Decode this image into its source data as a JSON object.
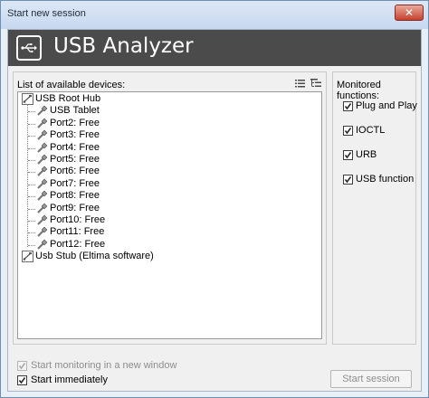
{
  "window": {
    "title": "Start new session",
    "close_glyph": "✕"
  },
  "header": {
    "app_title": "USB Analyzer",
    "logo_icon": "usb-icon"
  },
  "devices": {
    "label": "List of available devices:",
    "view_icons": [
      "list-view-icon",
      "tree-view-icon"
    ],
    "tree": [
      {
        "label": "USB Root Hub",
        "icon": "usb-hub-icon",
        "level": 0
      },
      {
        "label": "USB Tablet",
        "icon": "usb-plug-icon",
        "level": 1
      },
      {
        "label": "Port2: Free",
        "icon": "usb-plug-icon",
        "level": 1
      },
      {
        "label": "Port3: Free",
        "icon": "usb-plug-icon",
        "level": 1
      },
      {
        "label": "Port4: Free",
        "icon": "usb-plug-icon",
        "level": 1
      },
      {
        "label": "Port5: Free",
        "icon": "usb-plug-icon",
        "level": 1
      },
      {
        "label": "Port6: Free",
        "icon": "usb-plug-icon",
        "level": 1
      },
      {
        "label": "Port7: Free",
        "icon": "usb-plug-icon",
        "level": 1
      },
      {
        "label": "Port8: Free",
        "icon": "usb-plug-icon",
        "level": 1
      },
      {
        "label": "Port9: Free",
        "icon": "usb-plug-icon",
        "level": 1
      },
      {
        "label": "Port10: Free",
        "icon": "usb-plug-icon",
        "level": 1
      },
      {
        "label": "Port11: Free",
        "icon": "usb-plug-icon",
        "level": 1
      },
      {
        "label": "Port12: Free",
        "icon": "usb-plug-icon",
        "level": 1
      },
      {
        "label": "Usb Stub (Eltima software)",
        "icon": "usb-hub-icon",
        "level": 0
      }
    ]
  },
  "functions": {
    "label": "Monitored functions:",
    "items": [
      {
        "label": "Plug and Play",
        "checked": true
      },
      {
        "label": "IOCTL",
        "checked": true
      },
      {
        "label": "URB",
        "checked": true
      },
      {
        "label": "USB function",
        "checked": true
      }
    ]
  },
  "options": {
    "new_window": {
      "label": "Start monitoring in a new window",
      "checked": true,
      "enabled": false
    },
    "start_immediately": {
      "label": "Start immediately",
      "checked": true,
      "enabled": true
    }
  },
  "start_button": {
    "label": "Start session",
    "enabled": false
  },
  "colors": {
    "header_bg": "#4b4b4b",
    "title_bar": "#c7d8ee",
    "close_button": "#c7412d",
    "disabled_text": "#8d8d8d"
  }
}
